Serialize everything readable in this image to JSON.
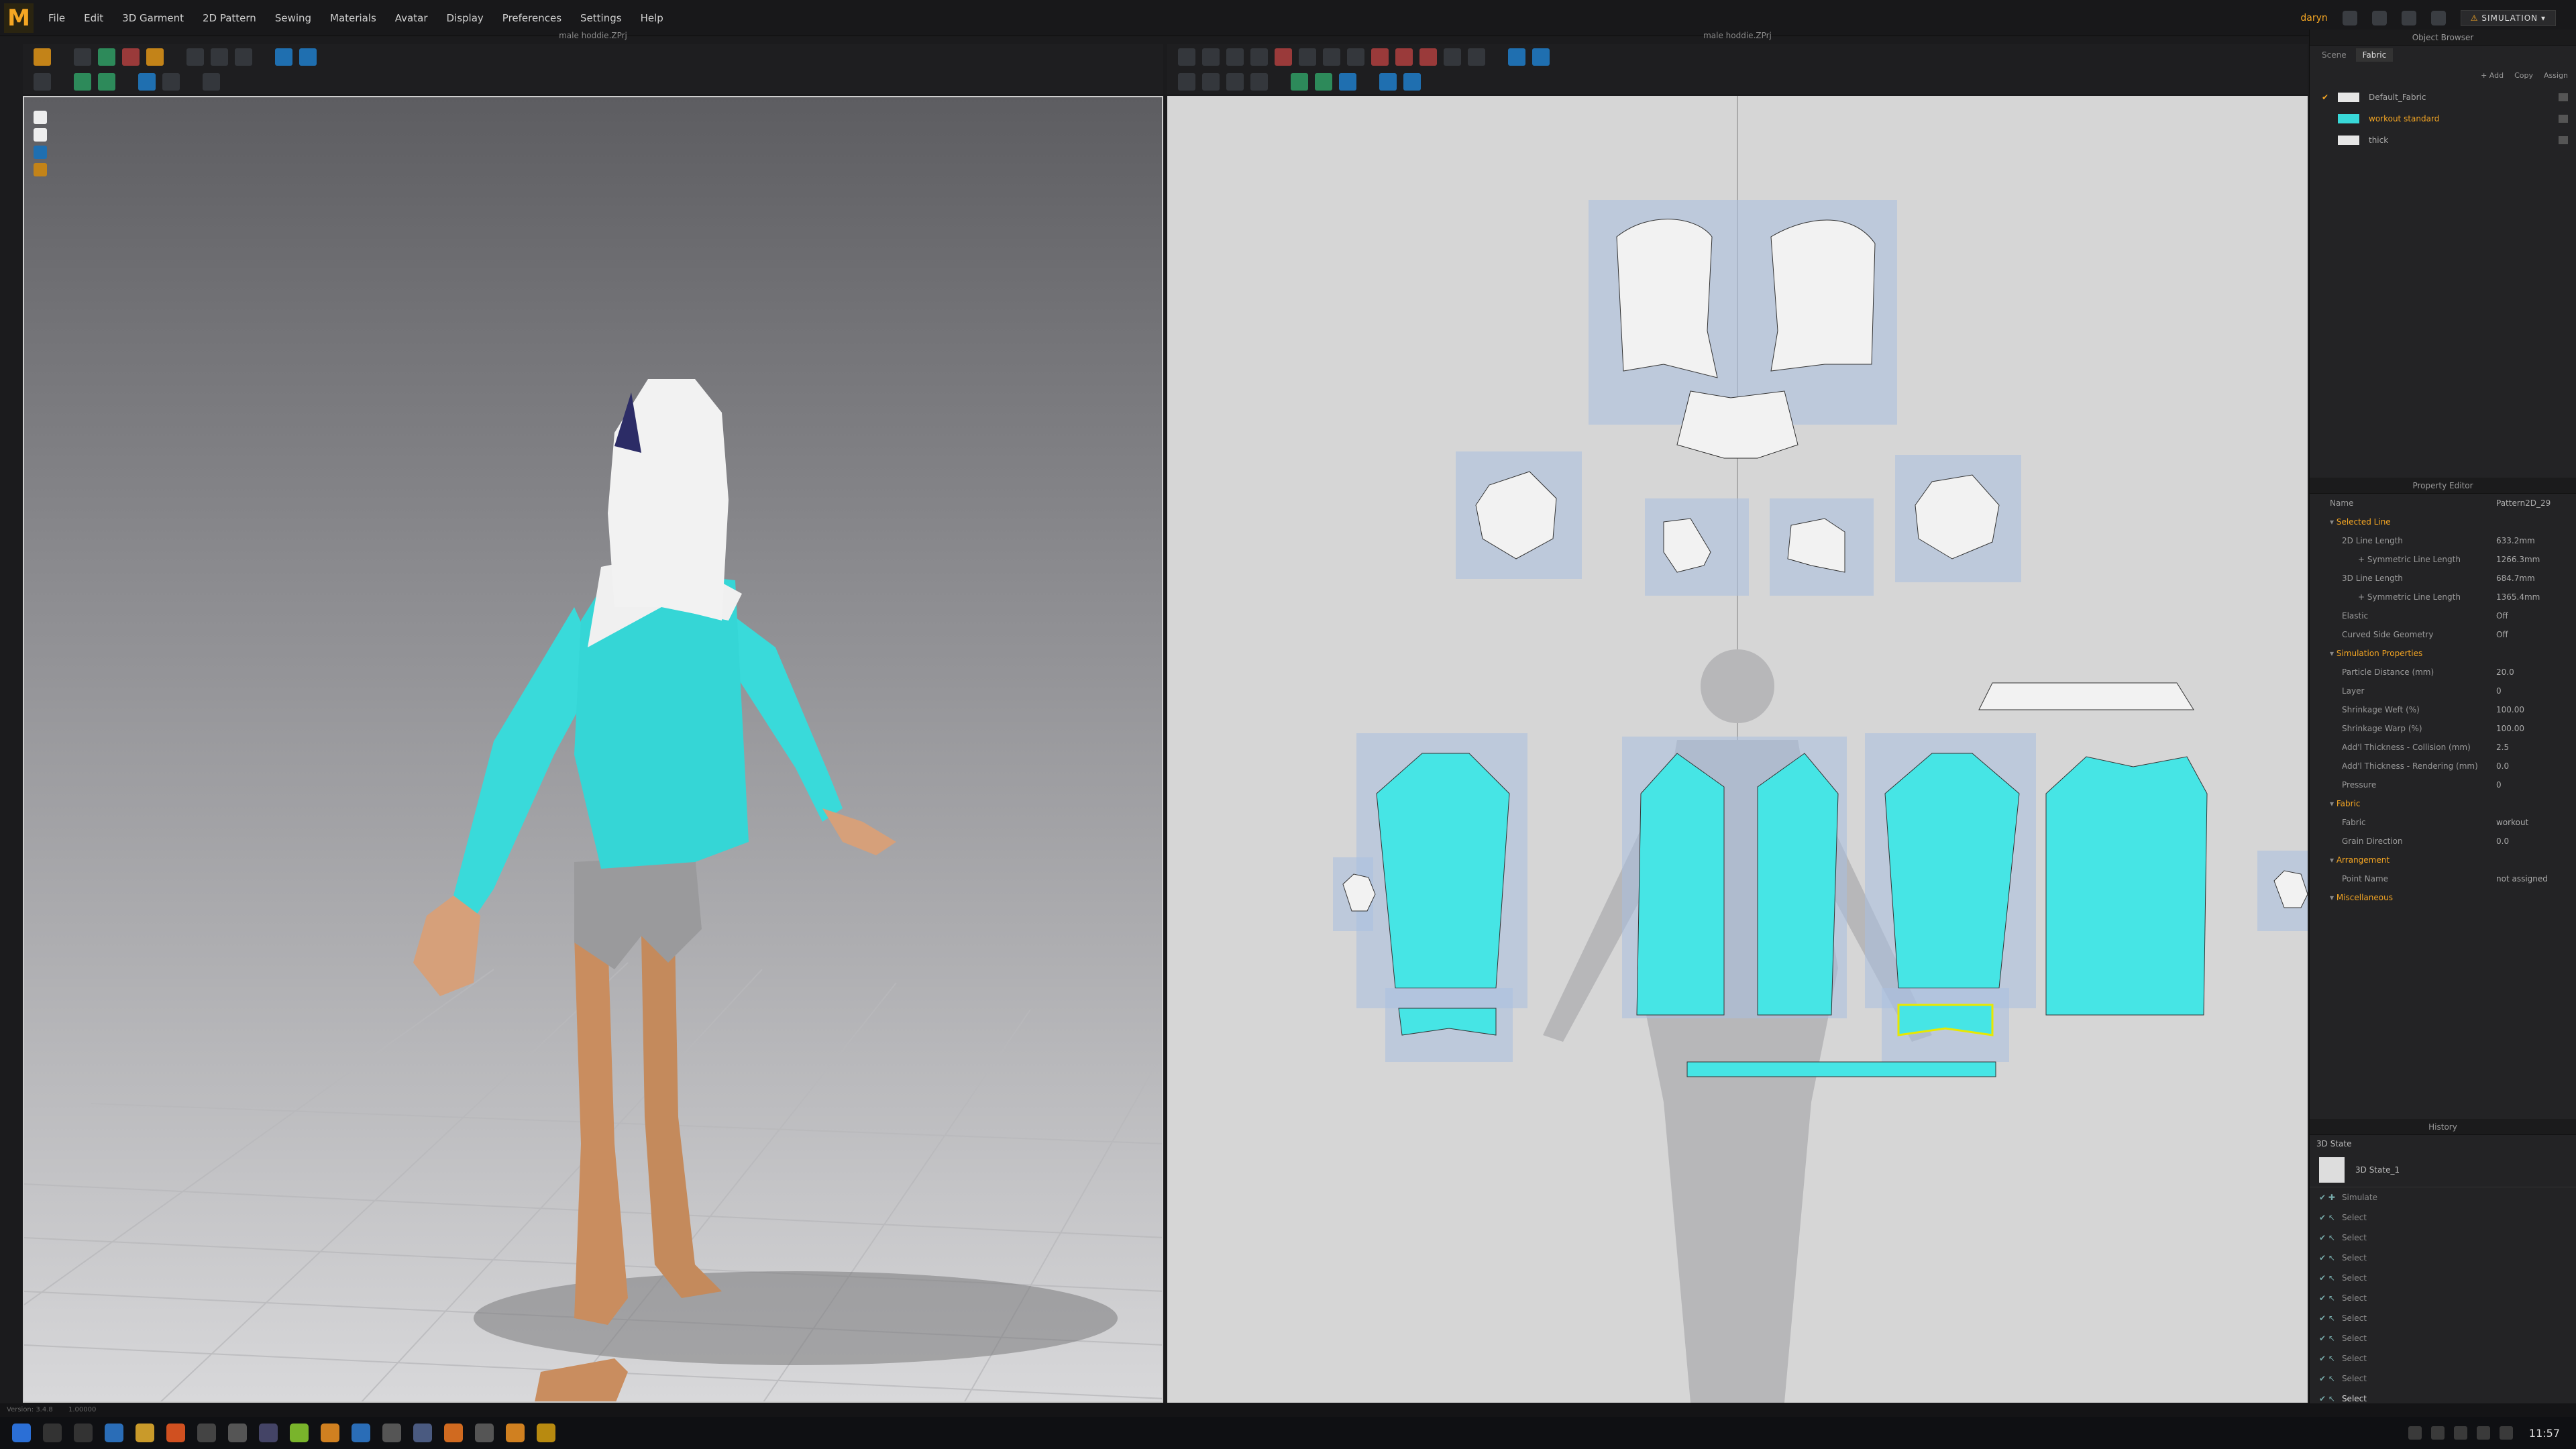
{
  "menu": [
    "File",
    "Edit",
    "3D Garment",
    "2D Pattern",
    "Sewing",
    "Materials",
    "Avatar",
    "Display",
    "Preferences",
    "Settings",
    "Help"
  ],
  "header": {
    "user": "daryn",
    "mode_label": "SIMULATION"
  },
  "windows": {
    "left_title": "male hoddie.ZPrj",
    "right_title": "male hoddie.ZPrj"
  },
  "object_browser": {
    "title": "Object Browser",
    "tabs": [
      "Scene",
      "Fabric"
    ],
    "actions": [
      "+ Add",
      "Copy",
      "Assign"
    ],
    "fabrics": [
      {
        "name": "Default_Fabric",
        "color": "#e6e6e6"
      },
      {
        "name": "workout standard",
        "color": "#38d8d8"
      },
      {
        "name": "thick",
        "color": "#e6e6e6"
      }
    ]
  },
  "property_editor": {
    "title": "Property Editor",
    "name_label": "Name",
    "name_value": "Pattern2D_29",
    "sections": {
      "selected_line": "Selected Line",
      "simulation": "Simulation Properties",
      "fabric": "Fabric",
      "arrangement": "Arrangement",
      "misc": "Miscellaneous"
    },
    "selected_line": [
      {
        "k": "2D Line Length",
        "v": "633.2mm",
        "indent": false
      },
      {
        "k": "+ Symmetric Line Length",
        "v": "1266.3mm",
        "indent": true
      },
      {
        "k": "3D Line Length",
        "v": "684.7mm",
        "indent": false
      },
      {
        "k": "+ Symmetric Line Length",
        "v": "1365.4mm",
        "indent": true
      },
      {
        "k": "Elastic",
        "v": "Off",
        "indent": false
      },
      {
        "k": "Curved Side Geometry",
        "v": "Off",
        "indent": false
      }
    ],
    "simulation": [
      {
        "k": "Particle Distance (mm)",
        "v": "20.0"
      },
      {
        "k": "Layer",
        "v": "0"
      },
      {
        "k": "Shrinkage Weft (%)",
        "v": "100.00"
      },
      {
        "k": "Shrinkage Warp (%)",
        "v": "100.00"
      },
      {
        "k": "Add'l Thickness - Collision (mm)",
        "v": "2.5"
      },
      {
        "k": "Add'l Thickness - Rendering (mm)",
        "v": "0.0"
      },
      {
        "k": "Pressure",
        "v": "0"
      }
    ],
    "fabric": [
      {
        "k": "Fabric",
        "v": "workout"
      },
      {
        "k": "Grain Direction",
        "v": "0.0"
      }
    ],
    "arrangement": [
      {
        "k": "Point Name",
        "v": "not assigned"
      }
    ]
  },
  "history": {
    "title": "History",
    "header": "3D State",
    "state_name": "3D State_1",
    "items": [
      "Simulate",
      "Select",
      "Select",
      "Select",
      "Select",
      "Select",
      "Select",
      "Select",
      "Select",
      "Select",
      "Select"
    ]
  },
  "status": {
    "version": "Version: 3.4.8",
    "info": "1.00000"
  },
  "clock": "11:57"
}
